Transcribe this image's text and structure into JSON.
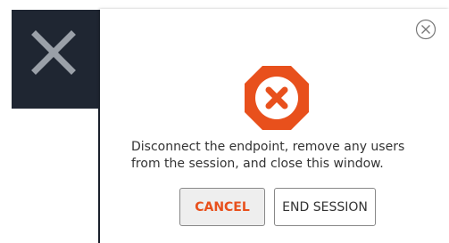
{
  "background": {
    "close_icon": "close-x-icon",
    "panel_color": "#1f2632"
  },
  "dialog": {
    "close_icon": "circle-close-icon",
    "alert_icon": "octagon-x-icon",
    "alert_color": "#e8501c",
    "message_line1": "Disconnect the endpoint, remove any users",
    "message_line2": "from the session, and close this window.",
    "cancel_label": "CANCEL",
    "end_session_label": "END SESSION"
  }
}
